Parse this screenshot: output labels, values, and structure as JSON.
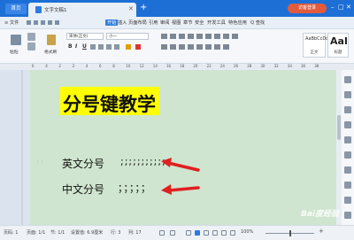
{
  "titlebar": {
    "home_tab": "首页",
    "doc_tab": "文字文稿1",
    "close_symbol": "✕",
    "add_symbol": "+",
    "login_button": "访客登录",
    "minimize": "–",
    "maximize": "□",
    "close": "✕"
  },
  "menu": {
    "file": "≡ 文件",
    "items": [
      "开始",
      "插入",
      "页面布局",
      "引用",
      "审阅",
      "视图",
      "章节",
      "安全",
      "开发工具",
      "特色应用"
    ],
    "search": "Q 查找"
  },
  "toolbar": {
    "paste": "粘贴",
    "format_painter": "格式刷",
    "font_name": "宋体(正文)",
    "font_size": "小一",
    "bold": "B",
    "italic": "I",
    "underline": "U",
    "style_sample": "AaBbCcDd",
    "style_big": "AaI",
    "style_normal": "正文",
    "style_title": "标题"
  },
  "ruler": {
    "numbers": [
      "6",
      "4",
      "2",
      "2",
      "4",
      "6",
      "8",
      "10",
      "12",
      "14",
      "16",
      "18",
      "20",
      "22",
      "24",
      "26",
      "28",
      "30",
      "32",
      "34",
      "36",
      "38"
    ]
  },
  "document": {
    "heading": "分号键教学",
    "line1_label": "英文分号",
    "line1_value": ";;;;;;;;;;;",
    "line2_label": "中文分号",
    "line2_value": "；；；；；"
  },
  "statusbar": {
    "page_no": "页码: 1",
    "pages": "页面: 1/1",
    "section": "节: 1/1",
    "position": "设置值: 6.9厘米",
    "line": "行: 3",
    "column": "列: 17",
    "zoom": "100%"
  },
  "watermark": "Bai度经验",
  "colors": {
    "titlebar": "#1d6fd6",
    "page_background": "#cfe5cf",
    "heading_highlight": "#ffff00",
    "arrow": "#e02020",
    "login_button": "#e15b3c"
  }
}
